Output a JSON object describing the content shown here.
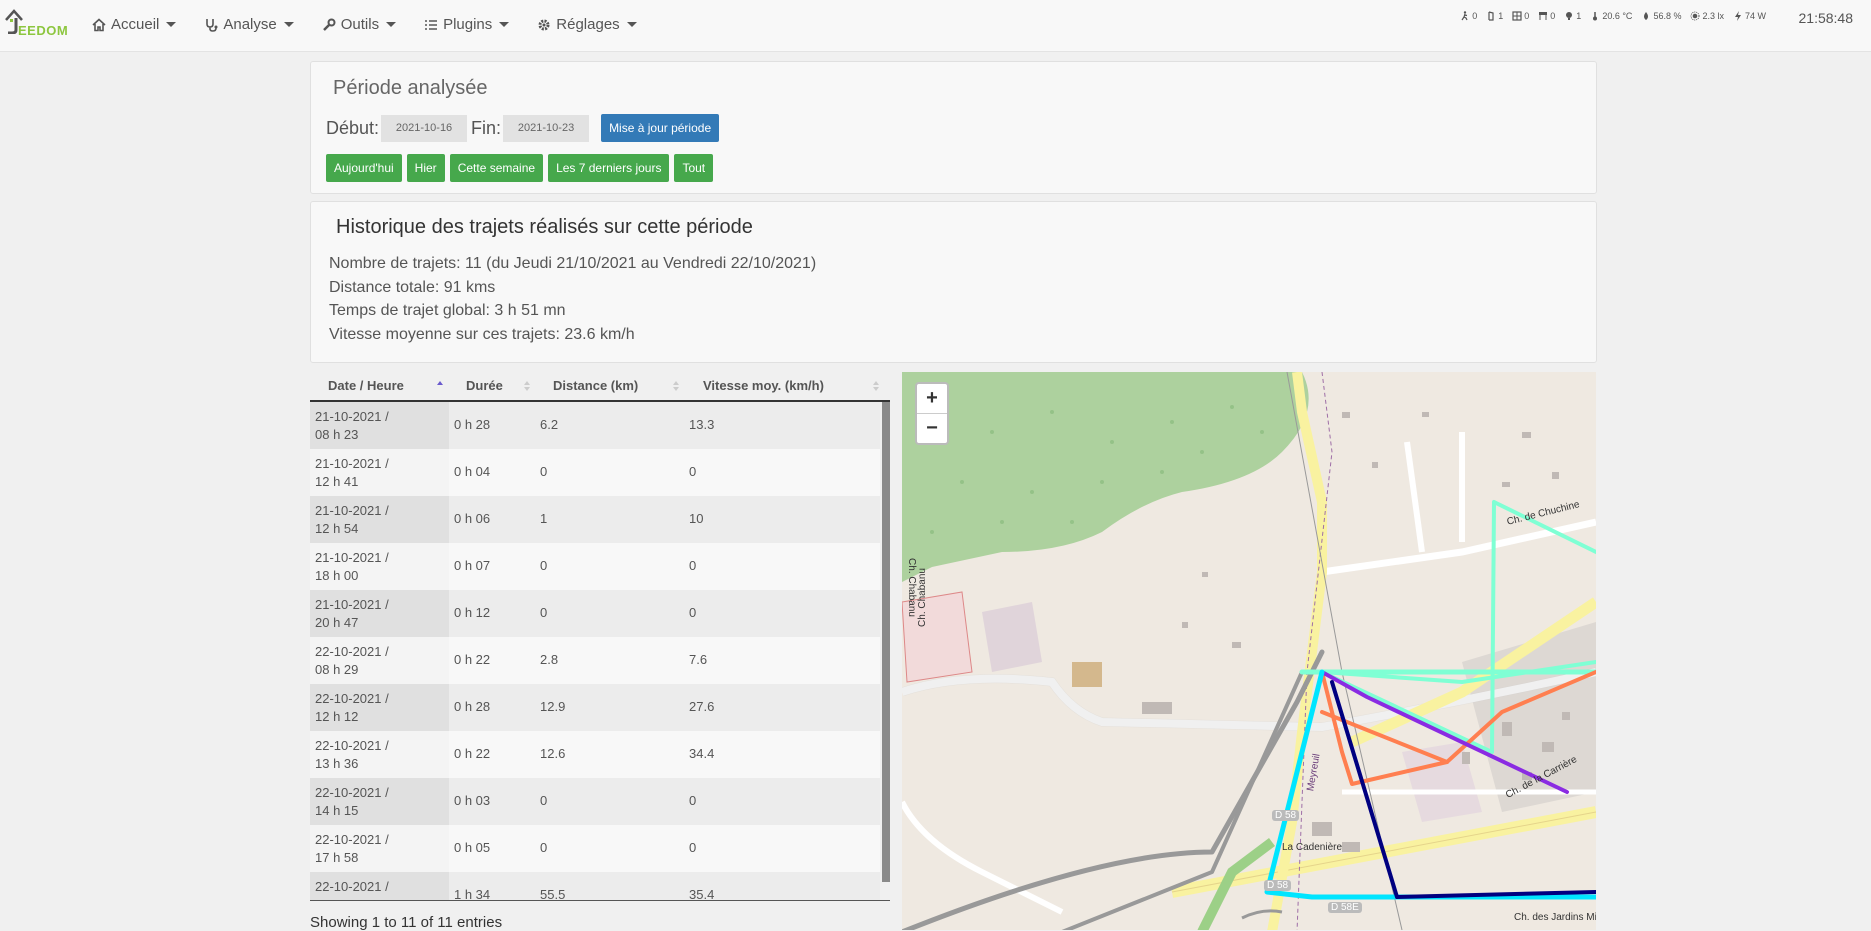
{
  "navbar": {
    "logo_text": "EEDOM",
    "menu": [
      {
        "label": "Accueil",
        "icon": "home-icon"
      },
      {
        "label": "Analyse",
        "icon": "stethoscope-icon"
      },
      {
        "label": "Outils",
        "icon": "wrench-icon"
      },
      {
        "label": "Plugins",
        "icon": "list-icon"
      },
      {
        "label": "Réglages",
        "icon": "gear-icon"
      }
    ],
    "status": [
      {
        "icon": "motion-icon",
        "value": "0"
      },
      {
        "icon": "door-icon",
        "value": "1"
      },
      {
        "icon": "window-icon",
        "value": "0"
      },
      {
        "icon": "shutter-icon",
        "value": "0"
      },
      {
        "icon": "light-icon",
        "value": "1"
      },
      {
        "icon": "thermometer-icon",
        "value": "20.6 °C"
      },
      {
        "icon": "humidity-icon",
        "value": "56.8 %"
      },
      {
        "icon": "luminosity-icon",
        "value": "2.3 lx"
      },
      {
        "icon": "power-icon",
        "value": "74 W"
      }
    ],
    "clock": "21:58:48"
  },
  "periode": {
    "title": "Période analysée",
    "debut_label": "Début:",
    "debut_value": "2021-10-16",
    "fin_label": "Fin:",
    "fin_value": "2021-10-23",
    "update_button": "Mise à jour période",
    "quick_buttons": [
      "Aujourd'hui",
      "Hier",
      "Cette semaine",
      "Les 7 derniers jours",
      "Tout"
    ]
  },
  "historique": {
    "title": "Historique des trajets réalisés sur cette période",
    "lines": [
      "Nombre de trajets: 11 (du Jeudi 21/10/2021 au Vendredi 22/10/2021)",
      "Distance totale: 91 kms",
      "Temps de trajet global: 3 h 51 mn",
      "Vitesse moyenne sur ces trajets: 23.6 km/h"
    ]
  },
  "table": {
    "headers": [
      "Date / Heure",
      "Durée",
      "Distance (km)",
      "Vitesse moy. (km/h)"
    ],
    "rows": [
      {
        "date": "21-10-2021 /",
        "time": "08 h 23",
        "duree": "0 h 28",
        "distance": "6.2",
        "vitesse": "13.3"
      },
      {
        "date": "21-10-2021 /",
        "time": "12 h 41",
        "duree": "0 h 04",
        "distance": "0",
        "vitesse": "0"
      },
      {
        "date": "21-10-2021 /",
        "time": "12 h 54",
        "duree": "0 h 06",
        "distance": "1",
        "vitesse": "10"
      },
      {
        "date": "21-10-2021 /",
        "time": "18 h 00",
        "duree": "0 h 07",
        "distance": "0",
        "vitesse": "0"
      },
      {
        "date": "21-10-2021 /",
        "time": "20 h 47",
        "duree": "0 h 12",
        "distance": "0",
        "vitesse": "0"
      },
      {
        "date": "22-10-2021 /",
        "time": "08 h 29",
        "duree": "0 h 22",
        "distance": "2.8",
        "vitesse": "7.6"
      },
      {
        "date": "22-10-2021 /",
        "time": "12 h 12",
        "duree": "0 h 28",
        "distance": "12.9",
        "vitesse": "27.6"
      },
      {
        "date": "22-10-2021 /",
        "time": "13 h 36",
        "duree": "0 h 22",
        "distance": "12.6",
        "vitesse": "34.4"
      },
      {
        "date": "22-10-2021 /",
        "time": "14 h 15",
        "duree": "0 h 03",
        "distance": "0",
        "vitesse": "0"
      },
      {
        "date": "22-10-2021 /",
        "time": "17 h 58",
        "duree": "0 h 05",
        "distance": "0",
        "vitesse": "0"
      },
      {
        "date": "22-10-2021 /",
        "time": "",
        "duree": "1 h 34",
        "distance": "55.5",
        "vitesse": "35.4"
      }
    ],
    "info": "Showing 1 to 11 of 11 entries"
  },
  "map": {
    "zoom_in": "+",
    "zoom_out": "−",
    "labels": {
      "chuchine": "Ch. de Chuchine",
      "chabanu_v": "Ch. Chabanu",
      "chabanu_v2": "Ch. Chabanu",
      "meyreuil": "Meyreuil",
      "carriere": "Ch. de la Carrière",
      "cadeniere": "La Cadenière",
      "d58": "D 58",
      "d58b": "D 58",
      "d58e": "D 58E",
      "jardins": "Ch. des Jardins Mi"
    },
    "route_colors": [
      "#ff7f50",
      "#7fffd4",
      "#8a2be2",
      "#000080",
      "#00e5ff",
      "#999999"
    ]
  }
}
